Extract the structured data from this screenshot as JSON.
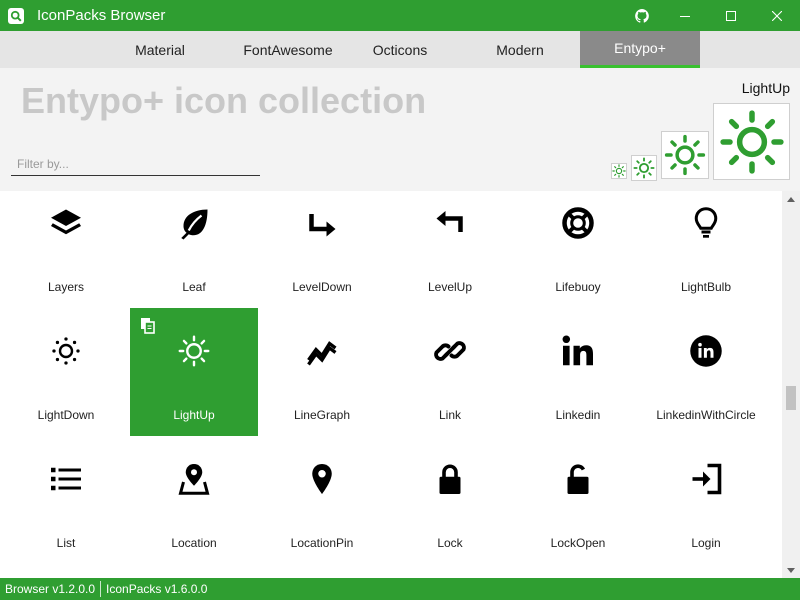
{
  "window": {
    "title": "IconPacks Browser"
  },
  "tabs": [
    {
      "label": "Material"
    },
    {
      "label": "FontAwesome"
    },
    {
      "label": "Octicons"
    },
    {
      "label": "Modern"
    },
    {
      "label": "Entypo+",
      "selected": true
    }
  ],
  "header": {
    "collection_title": "Entypo+ icon collection",
    "filter_placeholder": "Filter by...",
    "filter_value": "",
    "selected_icon_name": "LightUp"
  },
  "colors": {
    "accent": "#2f9e31",
    "tab_selected_bg": "#8a8a8a",
    "tab_indicator": "#39c12f",
    "title_text": "#c8c8c8"
  },
  "icons": [
    {
      "label": "Layers",
      "icon": "layers-icon"
    },
    {
      "label": "Leaf",
      "icon": "leaf-icon"
    },
    {
      "label": "LevelDown",
      "icon": "level-down-icon"
    },
    {
      "label": "LevelUp",
      "icon": "level-up-icon"
    },
    {
      "label": "Lifebuoy",
      "icon": "lifebuoy-icon"
    },
    {
      "label": "LightBulb",
      "icon": "light-bulb-icon"
    },
    {
      "label": "LightDown",
      "icon": "light-down-icon"
    },
    {
      "label": "LightUp",
      "icon": "light-up-icon",
      "selected": true
    },
    {
      "label": "LineGraph",
      "icon": "line-graph-icon"
    },
    {
      "label": "Link",
      "icon": "link-icon"
    },
    {
      "label": "Linkedin",
      "icon": "linkedin-icon"
    },
    {
      "label": "LinkedinWithCircle",
      "icon": "linkedin-with-circle-icon"
    },
    {
      "label": "List",
      "icon": "list-icon"
    },
    {
      "label": "Location",
      "icon": "location-icon"
    },
    {
      "label": "LocationPin",
      "icon": "location-pin-icon"
    },
    {
      "label": "Lock",
      "icon": "lock-icon"
    },
    {
      "label": "LockOpen",
      "icon": "lock-open-icon"
    },
    {
      "label": "Login",
      "icon": "login-icon"
    }
  ],
  "status": {
    "browser_version": "Browser v1.2.0.0",
    "iconpacks_version": "IconPacks v1.6.0.0"
  }
}
